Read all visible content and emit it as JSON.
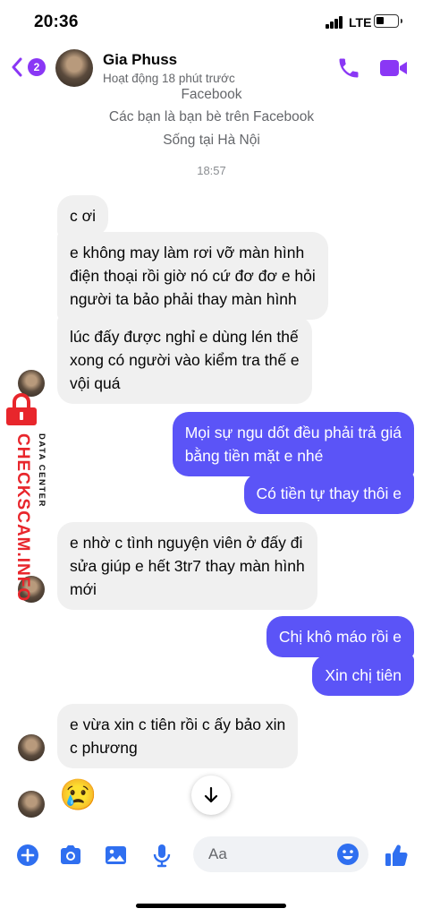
{
  "status_bar": {
    "time": "20:36",
    "network": "LTE"
  },
  "header": {
    "unread_count": "2",
    "contact_name": "Gia Phuss",
    "contact_status": "Hoạt động 18 phút trước",
    "accent_color": "#8a37f5"
  },
  "intro": {
    "lines": [
      "Facebook",
      "Các bạn là bạn bè trên Facebook",
      "Sống tại Hà Nội"
    ],
    "timestamp": "18:57"
  },
  "messages": [
    {
      "direction": "incoming",
      "lines": [
        "c ơi"
      ]
    },
    {
      "direction": "incoming",
      "lines": [
        "e không may làm rơi vỡ màn hình",
        "điện thoại rồi giờ nó cứ đơ đơ e hỏi",
        "người ta bảo phải thay màn hình"
      ]
    },
    {
      "direction": "incoming",
      "lines": [
        "lúc đấy được nghỉ e dùng lén thế",
        "xong có người vào kiểm tra thế e",
        "vội quá"
      ]
    },
    {
      "direction": "outgoing",
      "lines": [
        "Mọi sự ngu dốt đều phải trả giá",
        "bằng tiền mặt e nhé"
      ]
    },
    {
      "direction": "outgoing",
      "lines": [
        "Có tiền tự thay thôi e"
      ]
    },
    {
      "direction": "incoming",
      "lines": [
        "e nhờ c tình nguyện viên ở đấy đi",
        "sửa giúp e hết 3tr7 thay màn hình",
        "mới"
      ]
    },
    {
      "direction": "outgoing",
      "lines": [
        "Chị khô máo rồi e"
      ]
    },
    {
      "direction": "outgoing",
      "lines": [
        "Xin chị tiên"
      ]
    },
    {
      "direction": "incoming",
      "lines": [
        "e vừa xin c tiên rồi c ấy bảo xin",
        "c phương"
      ]
    },
    {
      "direction": "incoming",
      "emoji": "😢"
    }
  ],
  "watermark": {
    "main": "CHECKSCAM.INFO",
    "sub": "DATA CENTER"
  },
  "composer": {
    "placeholder": "Aa",
    "icons": [
      "plus-icon",
      "camera-icon",
      "gallery-icon",
      "microphone-icon",
      "emoji-icon",
      "thumbs-up-icon"
    ],
    "icon_color": "#2f6ff0"
  },
  "colors": {
    "incoming_bubble": "#f0f0f0",
    "outgoing_bubble": "#5b54f7"
  }
}
